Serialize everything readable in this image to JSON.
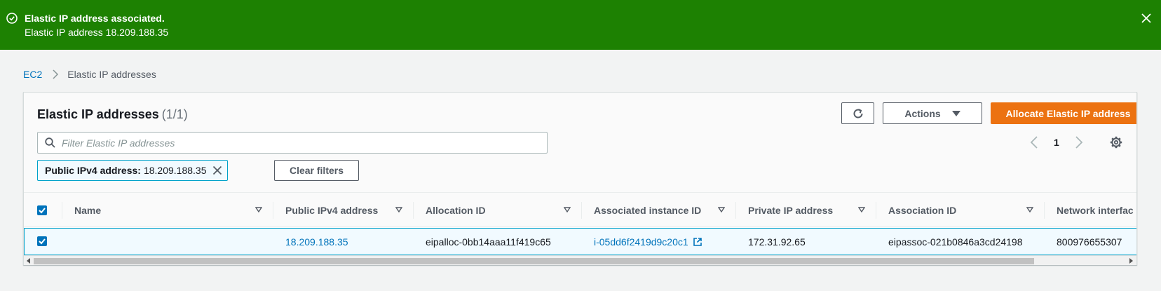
{
  "flash": {
    "title": "Elastic IP address associated.",
    "body": "Elastic IP address 18.209.188.35",
    "color": "#1d8102"
  },
  "breadcrumb": {
    "root": "EC2",
    "current": "Elastic IP addresses"
  },
  "panel": {
    "title": "Elastic IP addresses",
    "count": "(1/1)"
  },
  "toolbar": {
    "actions_label": "Actions",
    "allocate_label": "Allocate Elastic IP address",
    "accent": "#ec7211"
  },
  "filter": {
    "placeholder": "Filter Elastic IP addresses",
    "value": ""
  },
  "pagination": {
    "current_page": "1"
  },
  "token": {
    "key": "Public IPv4 address:",
    "value": "18.209.188.35"
  },
  "clear_filters_label": "Clear filters",
  "table": {
    "columns": [
      "Name",
      "Public IPv4 address",
      "Allocation ID",
      "Associated instance ID",
      "Private IP address",
      "Association ID",
      "Network interfac"
    ],
    "rows": [
      {
        "selected": true,
        "name": "",
        "public_ip": "18.209.188.35",
        "allocation_id": "eipalloc-0bb14aaa11f419c65",
        "instance_id": "i-05dd6f2419d9c20c1",
        "private_ip": "172.31.92.65",
        "association_id": "eipassoc-021b0846a3cd24198",
        "network_interface_owner": "800976655307"
      }
    ]
  }
}
